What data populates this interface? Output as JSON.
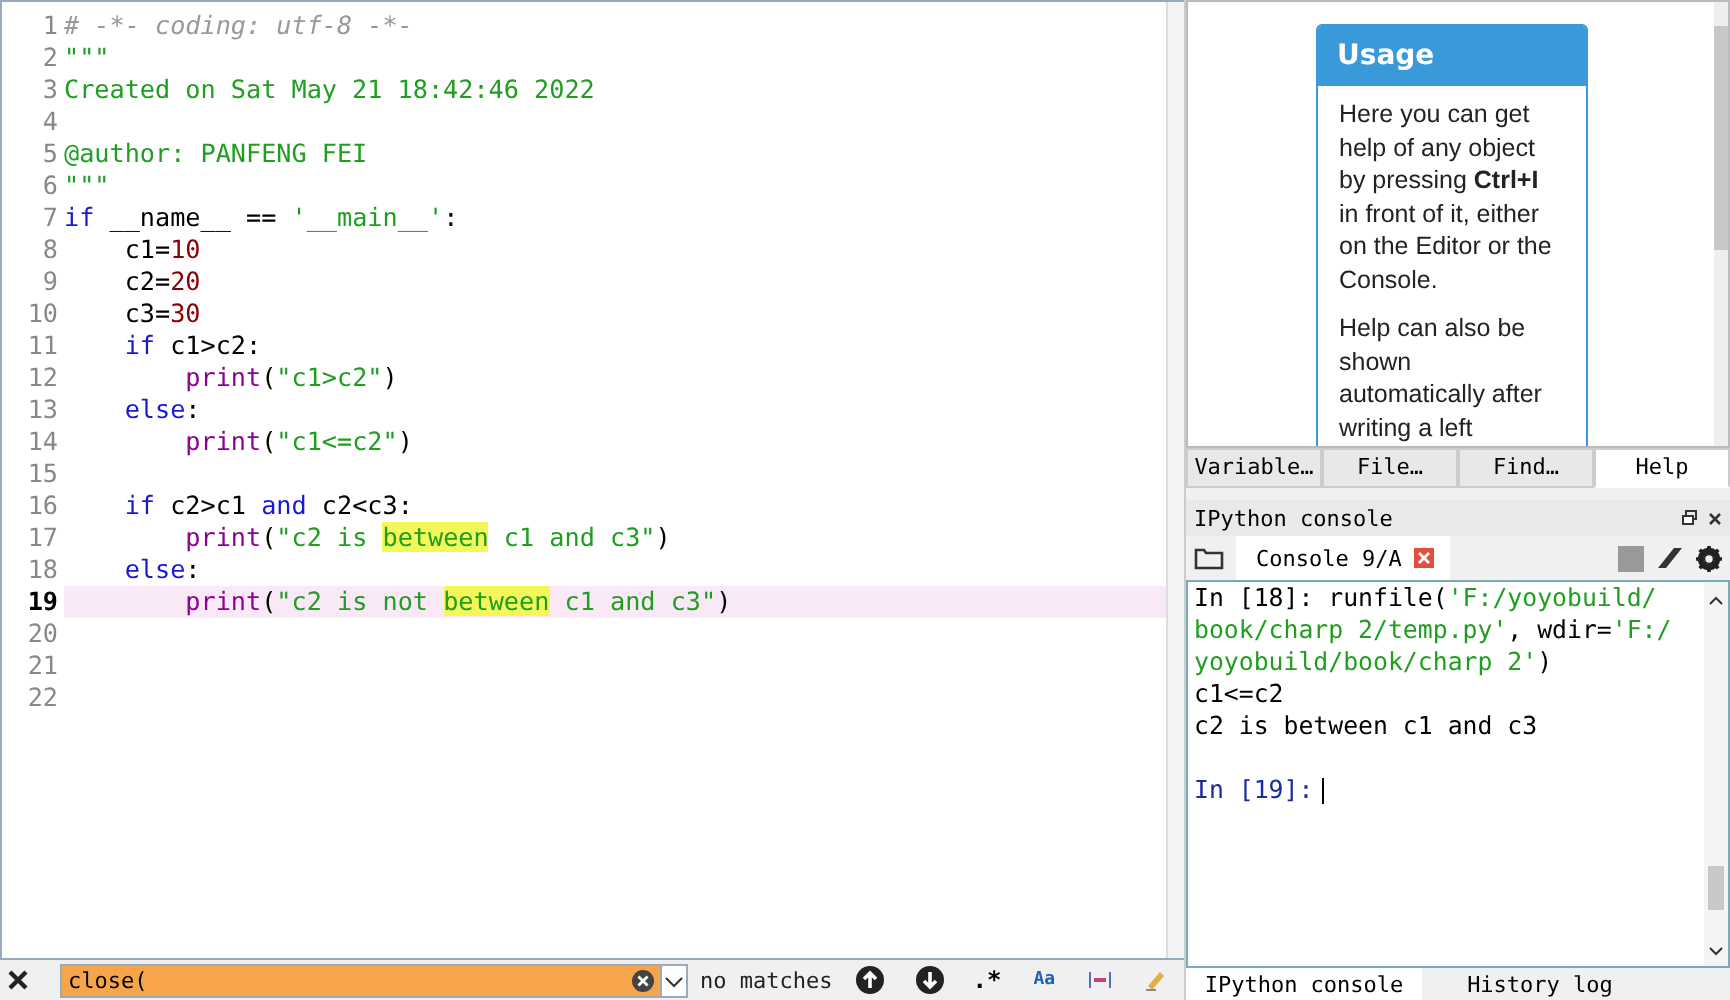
{
  "editor": {
    "lines": [
      {
        "number": "1",
        "current": false,
        "tokens": [
          {
            "kind": "comment",
            "text": "# -*- coding: utf-8 -*-"
          }
        ]
      },
      {
        "number": "2",
        "current": false,
        "tokens": [
          {
            "kind": "string",
            "text": "\"\"\""
          }
        ]
      },
      {
        "number": "3",
        "current": false,
        "tokens": [
          {
            "kind": "string",
            "text": "Created on Sat May 21 18:42:46 2022"
          }
        ]
      },
      {
        "number": "4",
        "current": false
      },
      {
        "number": "5",
        "current": false,
        "tokens": [
          {
            "kind": "string",
            "text": "@author: PANFENG FEI"
          }
        ]
      },
      {
        "number": "6",
        "current": false,
        "tokens": [
          {
            "kind": "string",
            "text": "\"\"\""
          }
        ]
      },
      {
        "number": "7",
        "current": false,
        "tokens": [
          {
            "kind": "keyword",
            "text": "if"
          },
          {
            "kind": "plain",
            "text": " __name__ == "
          },
          {
            "kind": "string",
            "text": "'__main__'"
          },
          {
            "kind": "plain",
            "text": ":"
          }
        ]
      },
      {
        "number": "8",
        "current": false,
        "tokens": [
          {
            "kind": "plain",
            "text": "    c1="
          },
          {
            "kind": "number",
            "text": "10"
          }
        ]
      },
      {
        "number": "9",
        "current": false,
        "tokens": [
          {
            "kind": "plain",
            "text": "    c2="
          },
          {
            "kind": "number",
            "text": "20"
          }
        ]
      },
      {
        "number": "10",
        "current": false,
        "tokens": [
          {
            "kind": "plain",
            "text": "    c3="
          },
          {
            "kind": "number",
            "text": "30"
          }
        ]
      },
      {
        "number": "11",
        "current": false,
        "tokens": [
          {
            "kind": "keyword",
            "text": "    if"
          },
          {
            "kind": "plain",
            "text": " c1>c2:"
          }
        ]
      },
      {
        "number": "12",
        "current": false,
        "tokens": [
          {
            "kind": "builtin",
            "text": "        print"
          },
          {
            "kind": "plain",
            "text": "("
          },
          {
            "kind": "string",
            "text": "\"c1>c2\""
          },
          {
            "kind": "plain",
            "text": ")"
          }
        ]
      },
      {
        "number": "13",
        "current": false,
        "tokens": [
          {
            "kind": "keyword",
            "text": "    else"
          },
          {
            "kind": "plain",
            "text": ":"
          }
        ]
      },
      {
        "number": "14",
        "current": false,
        "tokens": [
          {
            "kind": "builtin",
            "text": "        print"
          },
          {
            "kind": "plain",
            "text": "("
          },
          {
            "kind": "string",
            "text": "\"c1<=c2\""
          },
          {
            "kind": "plain",
            "text": ")"
          }
        ]
      },
      {
        "number": "15",
        "current": false
      },
      {
        "number": "16",
        "current": false,
        "tokens": [
          {
            "kind": "keyword",
            "text": "    if"
          },
          {
            "kind": "plain",
            "text": " c2>c1 "
          },
          {
            "kind": "keyword",
            "text": "and"
          },
          {
            "kind": "plain",
            "text": " c2<c3:"
          }
        ]
      },
      {
        "number": "17",
        "current": false,
        "tokens": [
          {
            "kind": "builtin",
            "text": "        print"
          },
          {
            "kind": "plain",
            "text": "("
          },
          {
            "kind": "string",
            "text": "\"c2 is "
          },
          {
            "kind": "match",
            "text": "between"
          },
          {
            "kind": "string",
            "text": " c1 and c3\""
          },
          {
            "kind": "plain",
            "text": ")"
          }
        ]
      },
      {
        "number": "18",
        "current": false,
        "tokens": [
          {
            "kind": "keyword",
            "text": "    else"
          },
          {
            "kind": "plain",
            "text": ":"
          }
        ]
      },
      {
        "number": "19",
        "current": true,
        "tokens": [
          {
            "kind": "builtin",
            "text": "        print"
          },
          {
            "kind": "plain",
            "text": "("
          },
          {
            "kind": "string",
            "text": "\"c2 is not "
          },
          {
            "kind": "match",
            "text": "between"
          },
          {
            "kind": "string",
            "text": " c1 and c3\""
          },
          {
            "kind": "plain",
            "text": ")"
          }
        ]
      },
      {
        "number": "20",
        "current": false
      },
      {
        "number": "21",
        "current": false
      },
      {
        "number": "22",
        "current": false
      }
    ]
  },
  "find_bar": {
    "value": "close(",
    "status": "no matches",
    "regex": ".*",
    "case": "Aa"
  },
  "help": {
    "title": "Usage",
    "paragraphs": [
      "Here you can get help of any object by pressing **Ctrl+I** in front of it, either on the Editor or the Console.",
      "Help can also be shown automatically after writing a left"
    ]
  },
  "top_tabs": [
    {
      "label": "Variable…",
      "selected": false
    },
    {
      "label": "File…",
      "selected": false
    },
    {
      "label": "Find…",
      "selected": false
    },
    {
      "label": "Help",
      "selected": true
    }
  ],
  "console": {
    "title": "IPython console",
    "tab": "Console 9/A",
    "lines": [
      {
        "tokens": [
          {
            "kind": "plain",
            "text": "In [18]: runfile("
          },
          {
            "kind": "string",
            "text": "'F:/yoyobuild/"
          }
        ]
      },
      {
        "tokens": [
          {
            "kind": "string",
            "text": "book/charp 2/temp.py'"
          },
          {
            "kind": "plain",
            "text": ", wdir="
          },
          {
            "kind": "string",
            "text": "'F:/"
          }
        ]
      },
      {
        "tokens": [
          {
            "kind": "string",
            "text": "yoyobuild/book/charp 2'"
          },
          {
            "kind": "plain",
            "text": ")"
          }
        ]
      },
      {
        "tokens": [
          {
            "kind": "plain",
            "text": "c1<=c2"
          }
        ]
      },
      {
        "tokens": [
          {
            "kind": "plain",
            "text": "c2 is between c1 and c3"
          }
        ]
      },
      {
        "tokens": [
          {
            "kind": "prompt",
            "text": "In [19]:"
          }
        ]
      }
    ]
  },
  "bottom_tabs": [
    {
      "label": "IPython console",
      "selected": true
    },
    {
      "label": "History log",
      "selected": false
    }
  ]
}
